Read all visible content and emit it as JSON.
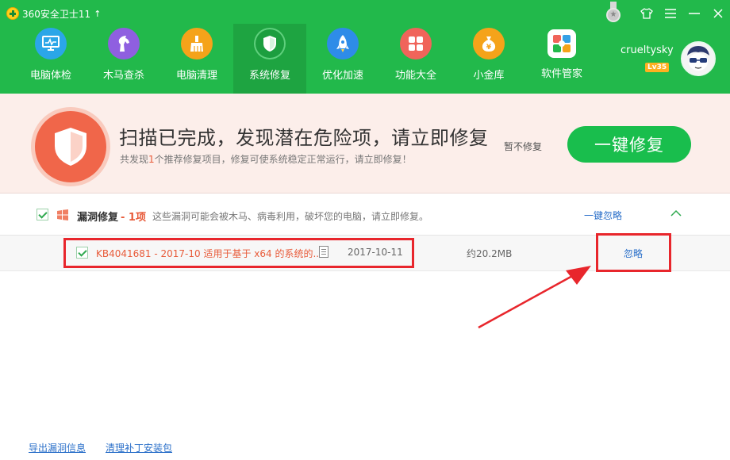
{
  "app": {
    "title": "360安全卫士11"
  },
  "nav": [
    {
      "label": "电脑体检",
      "icon": "monitor-icon",
      "color": "#2ba6e8"
    },
    {
      "label": "木马查杀",
      "icon": "horse-icon",
      "color": "#8f5fe0"
    },
    {
      "label": "电脑清理",
      "icon": "broom-icon",
      "color": "#f5a31a"
    },
    {
      "label": "系统修复",
      "icon": "shield-icon",
      "color": "#1c9e3f"
    },
    {
      "label": "优化加速",
      "icon": "rocket-icon",
      "color": "#2e8ce8"
    },
    {
      "label": "功能大全",
      "icon": "grid-icon",
      "color": "#f0645a"
    },
    {
      "label": "小金库",
      "icon": "money-bag-icon",
      "color": "#f5a31a"
    },
    {
      "label": "软件管家",
      "icon": "software-icon",
      "color": "#35a0e6"
    }
  ],
  "active_nav": "系统修复",
  "user": {
    "name": "crueltysky",
    "level": "Lv35"
  },
  "banner": {
    "title": "扫描已完成，发现潜在危险项，请立即修复",
    "subtitle_prefix": "共发现",
    "subtitle_count": "1",
    "subtitle_suffix": "个推荐修复项目，修复可使系统稳定正常运行，请立即修复！",
    "later_label": "暂不修复",
    "fix_button": "一键修复"
  },
  "section": {
    "title": "漏洞修复",
    "count_label": "- 1项",
    "description": "这些漏洞可能会被木马、病毒利用，破坏您的电脑，请立即修复。",
    "ignore_all": "一键忽略"
  },
  "patch": {
    "name": "KB4041681 - 2017-10 适用于基于 x64 的系统的...",
    "date": "2017-10-11",
    "size": "约20.2MB",
    "ignore": "忽略"
  },
  "footer": {
    "export_link": "导出漏洞信息",
    "clean_link": "清理补丁安装包"
  },
  "colors": {
    "header_green": "#22b94b",
    "accent_orange": "#e85b3a",
    "link_blue": "#2a6fc9",
    "highlight_red": "#e8262c"
  }
}
